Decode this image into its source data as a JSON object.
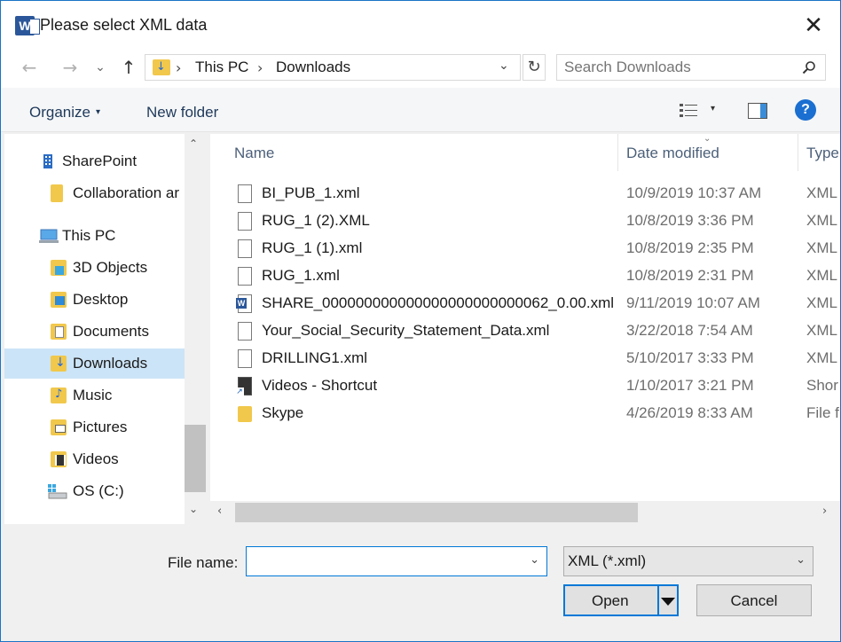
{
  "window": {
    "title": "Please select XML data",
    "app_icon": "W",
    "close": "✕"
  },
  "nav": {
    "back": "←",
    "forward": "→",
    "recent": "⌄",
    "up": "↑",
    "crumbs": [
      "This PC",
      "Downloads"
    ],
    "crumb_sep": "›",
    "dropdown": "⌄",
    "refresh": "↻",
    "search_placeholder": "Search Downloads"
  },
  "toolbar": {
    "organize": "Organize",
    "organize_caret": "▾",
    "new_folder": "New folder",
    "view_caret": "▾",
    "help": "?"
  },
  "sidebar": {
    "items": [
      {
        "label": "SharePoint",
        "icon": "building-icon"
      },
      {
        "label": "Collaboration ar",
        "icon": "folder-icon"
      },
      {
        "label": "This PC",
        "icon": "computer-icon"
      },
      {
        "label": "3D Objects",
        "icon": "cube-folder-icon"
      },
      {
        "label": "Desktop",
        "icon": "desktop-folder-icon"
      },
      {
        "label": "Documents",
        "icon": "documents-folder-icon"
      },
      {
        "label": "Downloads",
        "icon": "downloads-folder-icon",
        "selected": true
      },
      {
        "label": "Music",
        "icon": "music-folder-icon"
      },
      {
        "label": "Pictures",
        "icon": "pictures-folder-icon"
      },
      {
        "label": "Videos",
        "icon": "videos-folder-icon"
      },
      {
        "label": "OS (C:)",
        "icon": "drive-icon"
      }
    ],
    "scroll_up": "⌃",
    "scroll_down": "⌄"
  },
  "filelist": {
    "columns": {
      "name": "Name",
      "date": "Date modified",
      "type": "Type"
    },
    "sort_caret": "⌄",
    "rows": [
      {
        "name": "BI_PUB_1.xml",
        "date": "10/9/2019 10:37 AM",
        "type": "XML",
        "icon": "file-icon"
      },
      {
        "name": "RUG_1 (2).XML",
        "date": "10/8/2019 3:36 PM",
        "type": "XML",
        "icon": "file-icon"
      },
      {
        "name": "RUG_1 (1).xml",
        "date": "10/8/2019 2:35 PM",
        "type": "XML",
        "icon": "file-icon"
      },
      {
        "name": "RUG_1.xml",
        "date": "10/8/2019 2:31 PM",
        "type": "XML",
        "icon": "file-icon"
      },
      {
        "name": "SHARE_000000000000000000000000062_0.00.xml",
        "date": "9/11/2019 10:07 AM",
        "type": "XML",
        "icon": "word-doc-icon"
      },
      {
        "name": "Your_Social_Security_Statement_Data.xml",
        "date": "3/22/2018 7:54 AM",
        "type": "XML",
        "icon": "file-icon"
      },
      {
        "name": "DRILLING1.xml",
        "date": "5/10/2017 3:33 PM",
        "type": "XML",
        "icon": "file-icon"
      },
      {
        "name": "Videos - Shortcut",
        "date": "1/10/2017 3:21 PM",
        "type": "Shor",
        "icon": "shortcut-icon"
      },
      {
        "name": "Skype",
        "date": "4/26/2019 8:33 AM",
        "type": "File f",
        "icon": "folder-icon"
      }
    ],
    "scroll_left": "‹",
    "scroll_right": "›"
  },
  "footer": {
    "file_name_label": "File name:",
    "file_name_value": "",
    "file_name_caret": "⌄",
    "file_type": "XML (*.xml)",
    "file_type_caret": "⌄",
    "open": "Open",
    "cancel": "Cancel"
  }
}
